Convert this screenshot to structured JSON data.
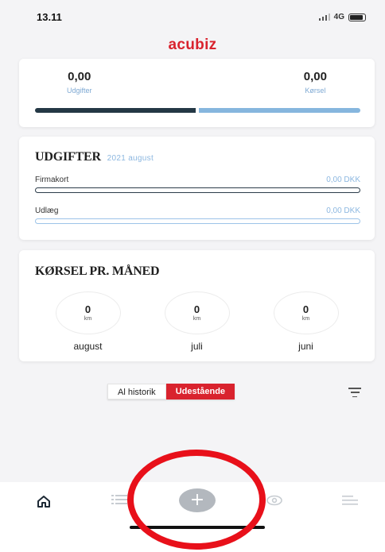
{
  "status_bar": {
    "time": "13.11",
    "network": "4G"
  },
  "app": {
    "brand": "acubiz"
  },
  "summary": {
    "left_value": "0,00",
    "left_label": "Udgifter",
    "right_value": "0,00",
    "right_label": "Kørsel"
  },
  "expenses": {
    "title": "UDGIFTER",
    "period": "2021 august",
    "rows": [
      {
        "label": "Firmakort",
        "amount": "0,00 DKK"
      },
      {
        "label": "Udlæg",
        "amount": "0,00 DKK"
      }
    ]
  },
  "mileage": {
    "title": "KØRSEL PR. MÅNED",
    "months": [
      {
        "value": "0",
        "unit": "km",
        "label": "august"
      },
      {
        "value": "0",
        "unit": "km",
        "label": "juli"
      },
      {
        "value": "0",
        "unit": "km",
        "label": "juni"
      }
    ]
  },
  "filter": {
    "option_all": "Al historik",
    "option_outstanding": "Udestående",
    "selected": "Udestående"
  },
  "tabbar": {
    "items": [
      {
        "icon": "home-icon"
      },
      {
        "icon": "list-icon"
      },
      {
        "icon": "plus-icon",
        "label": "+"
      },
      {
        "icon": "eye-icon"
      },
      {
        "icon": "menu-icon"
      }
    ]
  },
  "colors": {
    "brand": "#d9232e",
    "accent_blue": "#86b6de",
    "dark_bar": "#243845",
    "annotation": "#e8101a"
  }
}
